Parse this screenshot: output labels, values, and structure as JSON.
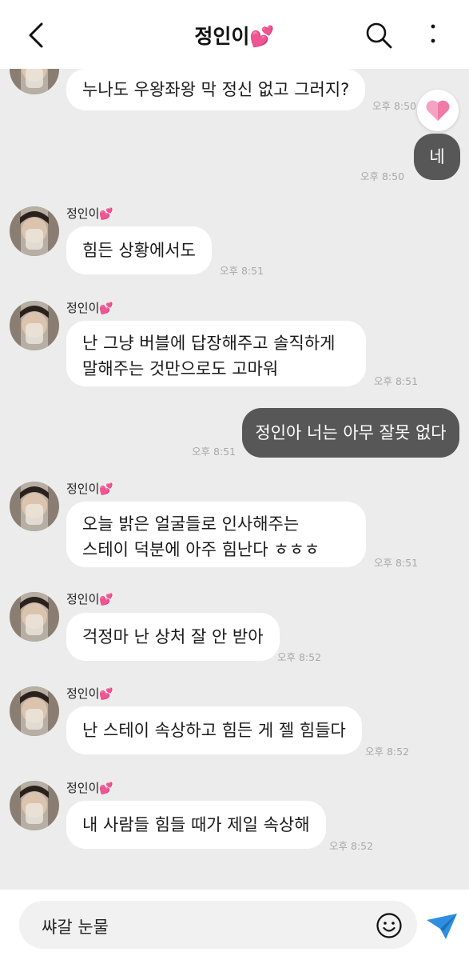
{
  "header": {
    "title": "정인이💕"
  },
  "reaction": {
    "icon": "pink-heart-icon"
  },
  "messages": [
    {
      "text": "누나도 우왕좌왕 막 정신 없고 그러지?",
      "time": "오후 8:50"
    },
    {
      "text": "네",
      "time": "오후 8:50"
    },
    {
      "name": "정인이",
      "text": "힘든 상황에서도",
      "time": "오후 8:51"
    },
    {
      "name": "정인이",
      "lines": [
        "난 그냥 버블에 답장해주고 솔직하게",
        "말해주는 것만으로도 고마워"
      ],
      "time": "오후 8:51"
    },
    {
      "text": "정인아 너는 아무 잘못 없다",
      "time": "오후 8:51"
    },
    {
      "name": "정인이",
      "lines": [
        "오늘 밝은 얼굴들로 인사해주는",
        "스테이 덕분에 아주 힘난다 ㅎㅎㅎ"
      ],
      "time": "오후 8:51"
    },
    {
      "name": "정인이",
      "text": "걱정마 난 상처 잘 안 받아",
      "time": "오후 8:52"
    },
    {
      "name": "정인이",
      "text": "난 스테이 속상하고 힘든 게 젤 힘들다",
      "time": "오후 8:52"
    },
    {
      "name": "정인이",
      "text": "내 사람들 힘들 때가 제일 속상해",
      "time": "오후 8:52"
    }
  ],
  "input": {
    "value": "쌰갈 눈물"
  },
  "colors": {
    "accent": "#2e8fe0",
    "my_bubble": "#575757",
    "heart": "#ff4fb8"
  }
}
